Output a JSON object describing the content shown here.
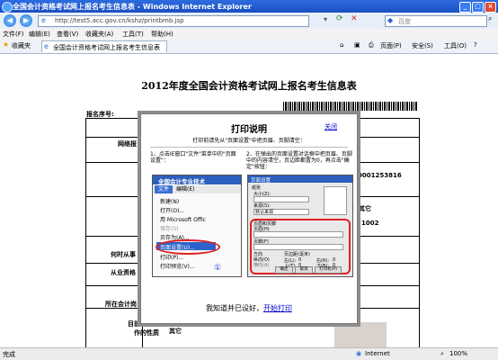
{
  "window": {
    "title": "全国会计资格考试网上报名考生信息表 - Windows Internet Explorer",
    "min_label": "_",
    "max_label": "□",
    "close_label": "×"
  },
  "address": {
    "url": "http://test5.acc.gov.cn/kshz/printbmb.jsp",
    "search_placeholder": "百度"
  },
  "menu": [
    "文件(F)",
    "编辑(E)",
    "查看(V)",
    "收藏夹(A)",
    "工具(T)",
    "帮助(H)"
  ],
  "favorites": {
    "label": "收藏夹",
    "tab_title": "全国会计资格考试网上报名考生信息表"
  },
  "toolbar": {
    "page_label": "页面(P)",
    "safety_label": "安全(S)",
    "tools_label": "工具(O)"
  },
  "page": {
    "heading": "2012年度全国会计资格考试网上报名考生信息表",
    "serial_label": "报名序号:",
    "fields": {
      "network": "网络报",
      "work_unit": "何时从事",
      "qualification": "从业资格",
      "location": "所在会计岗",
      "nature": "目前从事的工作的性质",
      "other_left": "其它",
      "other_right": "其它",
      "number1": "0001253816",
      "number2": "1002"
    }
  },
  "dialog": {
    "title": "打印说明",
    "close": "关闭",
    "intro": "打印前请先从\"页面设置\"中把页眉、页脚清空：",
    "step1": "1、点击IE窗口\"文件\"菜单中的\"页面设置\"：",
    "step2": "2、在弹出的页面设置对话框中把页眉、页脚中的内容清空，页边距都置为0，再点击\"确定\"按钮：",
    "shot_left": {
      "title": "全国会计专业技术",
      "file_menu": "文件(F)",
      "edit_menu": "编辑(E)",
      "items": [
        "新建(N)",
        "打开(O)...",
        "用 Microsoft Offic",
        "保存(S)",
        "另存为(A)...",
        "页面设置(U)...",
        "打印(P)...",
        "打印预览(V)..."
      ],
      "circle_number": "①"
    },
    "shot_right": {
      "title": "页面设置",
      "paper": "纸张",
      "size": "大小(Z):",
      "source": "来源(S):",
      "auto": "默认来源",
      "header_footer": "页眉和页脚",
      "header": "页眉(H)",
      "footer": "页脚(F)",
      "orientation": "方向",
      "portrait": "纵向(O)",
      "landscape": "横向(A)",
      "margins": "页边距(毫米)",
      "left": "左(L):",
      "right": "右(R):",
      "top": "上(T):",
      "bottom": "下(B):",
      "margin_value": "0",
      "ok": "确定",
      "cancel": "取消",
      "printer": "打印机(P)"
    },
    "footer_text": "我知道并已设好，",
    "footer_link": "开始打印"
  },
  "status": {
    "done": "完成",
    "zone": "Internet",
    "zoom": "100%"
  }
}
